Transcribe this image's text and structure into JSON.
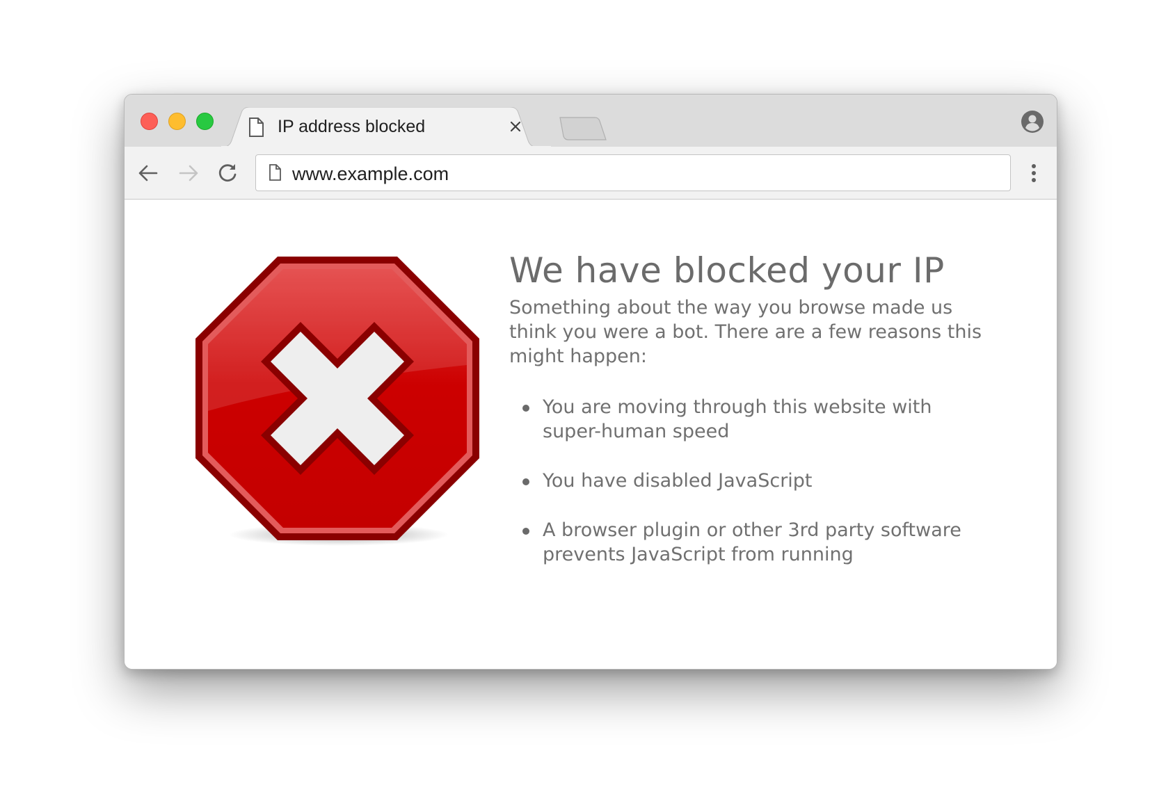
{
  "window": {
    "traffic_lights": [
      "close",
      "minimize",
      "zoom"
    ],
    "colors": {
      "close": "#fd5f57",
      "minimize": "#febd2f",
      "zoom": "#28c941"
    }
  },
  "tabs": [
    {
      "label": "IP address blocked",
      "icon": "document-icon",
      "active": true
    }
  ],
  "toolbar": {
    "url": "www.example.com",
    "icons": [
      "back-arrow-icon",
      "forward-arrow-icon",
      "reload-icon",
      "page-icon",
      "more-vert-icon",
      "profile-icon"
    ]
  },
  "page": {
    "headline": "We have blocked your IP",
    "intro": "Something about the way you browse made us think you were a bot. There are a few reasons this might happen:",
    "reasons": [
      "You are moving through this website with super-human speed",
      "You have disabled JavaScript",
      "A browser plugin or other 3rd party software prevents JavaScript from running"
    ],
    "graphic": "stop-sign-x-icon",
    "colors": {
      "stop_red": "#cc0000",
      "stop_border": "#8b0000",
      "text": "#707070"
    }
  }
}
